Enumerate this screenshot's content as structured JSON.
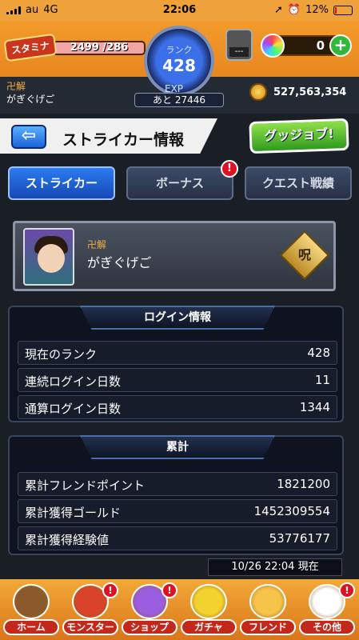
{
  "status_bar": {
    "carrier": "au",
    "network": "4G",
    "time": "22:06",
    "battery": "12%",
    "battery_level": 0.12
  },
  "header": {
    "stamina_label": "スタミナ",
    "stamina_value": "2499 /286",
    "rank_label": "ランク",
    "rank_value": "428",
    "exp_label": "EXP",
    "exp_next": "あと 27446",
    "orb_count": "0",
    "orb_slot_text": "---",
    "player_title": "卍解",
    "player_name": "がぎぐげご",
    "gold": "527,563,354"
  },
  "page": {
    "title": "ストライカー情報",
    "friend_button": "グッジョブ!"
  },
  "tabs": [
    {
      "label": "ストライカー",
      "active": true,
      "alert": false
    },
    {
      "label": "ボーナス",
      "active": false,
      "alert": true
    },
    {
      "label": "クエスト戦績",
      "active": false,
      "alert": false
    }
  ],
  "profile": {
    "title": "卍解",
    "name": "がぎぐげご",
    "badge": "呪"
  },
  "login_panel": {
    "heading": "ログイン情報",
    "rows": [
      {
        "label": "現在のランク",
        "value": "428"
      },
      {
        "label": "連続ログイン日数",
        "value": "11"
      },
      {
        "label": "通算ログイン日数",
        "value": "1344"
      }
    ]
  },
  "total_panel": {
    "heading": "累計",
    "rows": [
      {
        "label": "累計フレンドポイント",
        "value": "1821200"
      },
      {
        "label": "累計獲得ゴールド",
        "value": "1452309554"
      },
      {
        "label": "累計獲得経験値",
        "value": "53776177"
      }
    ]
  },
  "timestamp": "10/26 22:04 現在",
  "alert_mark": "!",
  "bottom_nav": [
    {
      "label": "ホーム",
      "alert": false,
      "color": "#8a5a2b"
    },
    {
      "label": "モンスター",
      "alert": true,
      "color": "#d8432a"
    },
    {
      "label": "ショップ",
      "alert": true,
      "color": "#9a5ee0"
    },
    {
      "label": "ガチャ",
      "alert": false,
      "color": "#f3d230"
    },
    {
      "label": "フレンド",
      "alert": false,
      "color": "#f6c44a"
    },
    {
      "label": "その他",
      "alert": true,
      "color": "#ffffff"
    }
  ]
}
